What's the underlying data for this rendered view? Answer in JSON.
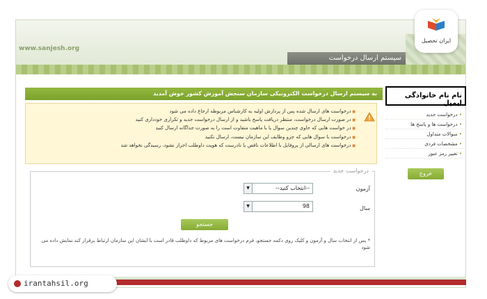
{
  "site_url": "www.sanjesh.org",
  "header_title": "سیستم ارسال درخواست",
  "logo_text": "ایران تحصیل",
  "welcome_text": "به سیستم ارسال درخواست الکترونیکی سازمان سنجش آموزش کشور خوش آمدید",
  "notice": [
    "درخواست های ارسال شده پس از پردازش اولیه به کارشناس مربوطه ارجاع داده می شود",
    "در صورت ارسال درخواست، منتظر دریافت پاسخ باشید و از ارسال درخواست جدید و تکراری خودداری کنید",
    "در خواست هایی که حاوی چندین سوال یا با ماهیت متفاوت است را به صورت جداگانه ارسال کنید",
    "درخواست با سوال هایی که جزو وظایف این سازمان نیست، ارسال نکنید",
    "درخواست های ارسالی از پروفایل با اطلاعات ناقص یا نادرست که هویت داوطلب احراز نشود، رسیدگی نخواهد شد"
  ],
  "user_header": "نام نام خانوادگی ایمیل",
  "menu": [
    "درخواست جدید",
    "درخواست ها و پاسخ ها",
    "سوالات متداول",
    "مشخصات فردی",
    "تغییر رمز عبور"
  ],
  "logout_label": "خروج",
  "form": {
    "legend": "درخواست جدید",
    "exam_label": "آزمون",
    "exam_value": "--انتخاب کنید--",
    "year_label": "سال",
    "year_value": "98",
    "search_label": "جستجو",
    "hint": "* پس از انتخاب سال و آزمون و کلیک روی دکمه جستجو، فرم درخواست های مربوط که داوطلب قادر است با ایشان این سازمان ارتباط برقرار کند نمایش داده می شود"
  },
  "footer_site": "irantahsil.org",
  "colors": {
    "green": "#85ab33",
    "red": "#b22c2c",
    "notice_bg": "#fff7d6"
  }
}
